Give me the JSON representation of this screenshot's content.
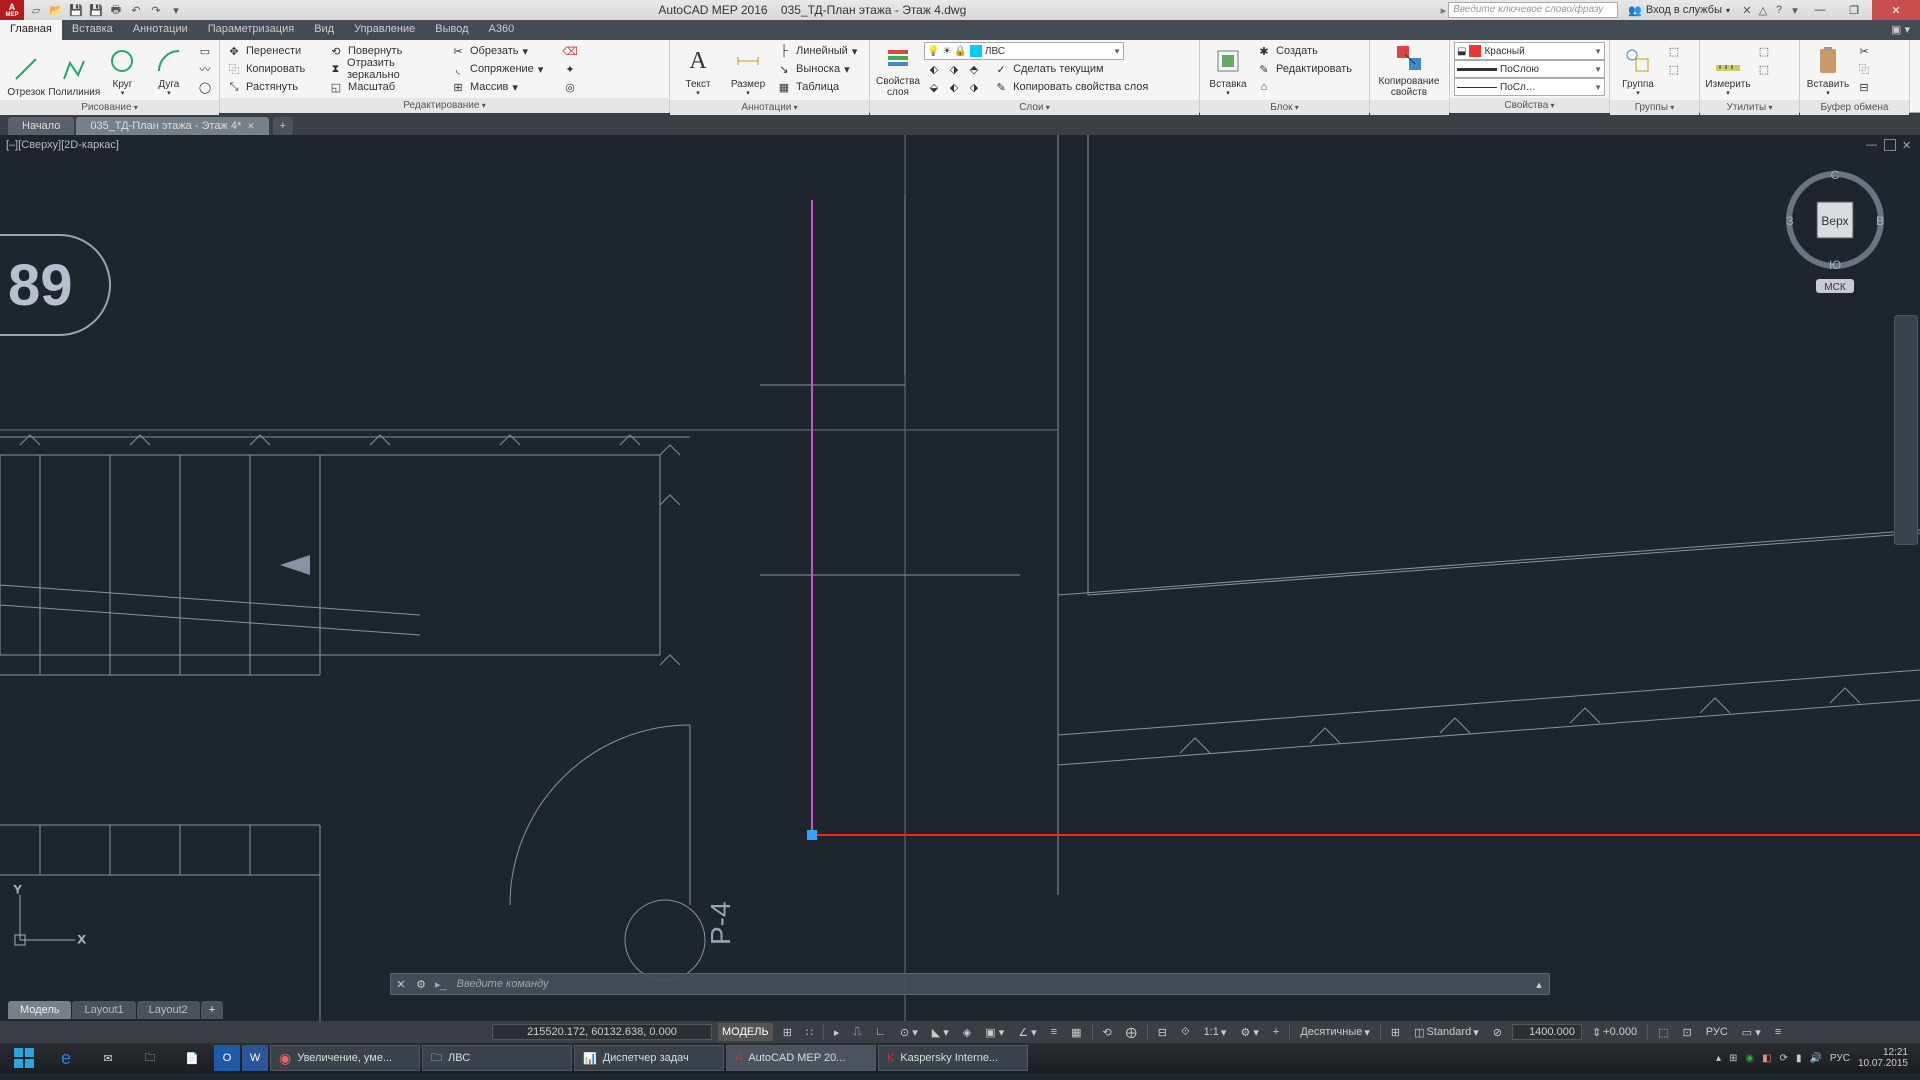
{
  "title": {
    "app": "AutoCAD MEP 2016",
    "file": "035_ТД-План этажа - Этаж 4.dwg"
  },
  "search": {
    "placeholder": "Введите ключевое слово/фразу"
  },
  "signin": {
    "label": "Вход в службы"
  },
  "menu": {
    "items": [
      "Главная",
      "Вставка",
      "Аннотации",
      "Параметризация",
      "Вид",
      "Управление",
      "Вывод",
      "A360"
    ],
    "active": 0
  },
  "ribbon": {
    "draw": {
      "title": "Рисование",
      "btns": [
        "Отрезок",
        "Полилиния",
        "Круг",
        "Дуга"
      ]
    },
    "modify": {
      "title": "Редактирование",
      "rows": [
        [
          "Перенести",
          "Повернуть",
          "Обрезать"
        ],
        [
          "Копировать",
          "Отразить зеркально",
          "Сопряжение"
        ],
        [
          "Растянуть",
          "Масштаб",
          "Массив"
        ]
      ]
    },
    "annot": {
      "title": "Аннотации",
      "big": [
        "Текст",
        "Размер"
      ],
      "rows": [
        "Линейный",
        "Выноска",
        "Таблица"
      ]
    },
    "layers": {
      "title": "Слои",
      "big": "Свойства\nслоя",
      "rows": [
        "Сделать текущим",
        "Копировать свойства слоя"
      ],
      "combo": "ЛВС"
    },
    "block": {
      "title": "Блок",
      "big": "Вставка",
      "rows": [
        "Создать",
        "Редактировать"
      ]
    },
    "clip": {
      "title": "",
      "big": "Копирование\nсвойств"
    },
    "props": {
      "title": "Свойства",
      "color": "Красный",
      "lt1": "ПоСлою",
      "lt2": "ПоСл…"
    },
    "groups": {
      "title": "Группы",
      "big": "Группа"
    },
    "utils": {
      "title": "Утилиты",
      "big": "Измерить"
    },
    "clipboard": {
      "title": "Буфер обмена",
      "big": "Вставить"
    }
  },
  "doctabs": {
    "items": [
      "Начало",
      "035_ТД-План этажа - Этаж 4*"
    ],
    "active": 1
  },
  "viewport": {
    "label": "[–][Сверху][2D-каркас]"
  },
  "viewcube": {
    "top": "С",
    "right": "В",
    "bottom": "Ю",
    "left": "З",
    "face": "Верх",
    "wcs": "МСК"
  },
  "room_label": "89",
  "axis_label": "P-4",
  "cmdline": {
    "placeholder": "Введите команду"
  },
  "layouttabs": {
    "items": [
      "Модель",
      "Layout1",
      "Layout2"
    ],
    "active": 0
  },
  "status": {
    "coords": "215520.172, 60132.638, 0.000",
    "space": "МОДЕЛЬ",
    "scale": "1:1",
    "units": "Десятичные",
    "style": "Standard",
    "num": "1400.000",
    "elev": "+0.000",
    "lang": "РУС"
  },
  "taskbar": {
    "apps": [
      {
        "label": "Увеличение, уме...",
        "icon": "firefox"
      },
      {
        "label": "ЛВС",
        "icon": "folder"
      },
      {
        "label": "Диспетчер задач",
        "icon": "taskmgr"
      },
      {
        "label": "AutoCAD MEP 20...",
        "icon": "acad",
        "active": true
      },
      {
        "label": "Kaspersky Interne...",
        "icon": "kav"
      }
    ],
    "lang": "РУС",
    "time": "12:21",
    "date": "10.07.2015"
  }
}
